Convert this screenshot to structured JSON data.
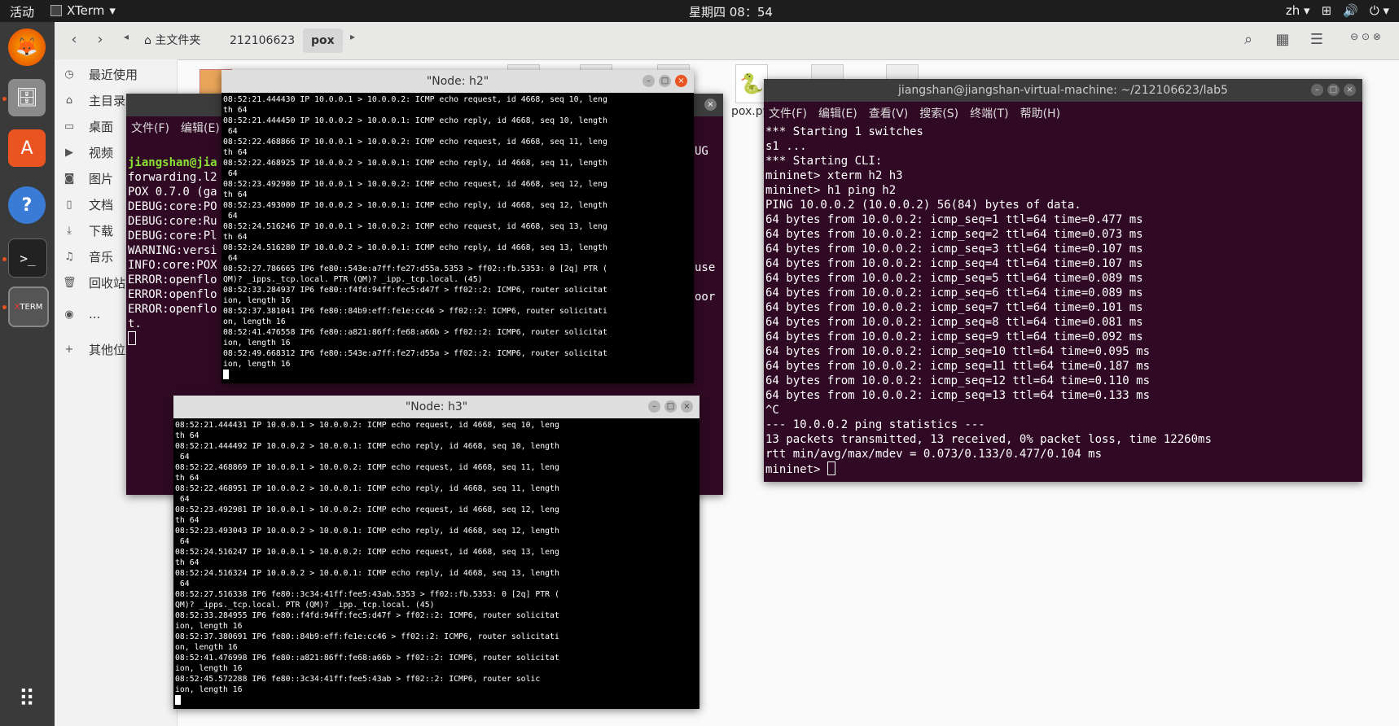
{
  "topbar": {
    "activities": "活动",
    "app_name": "XTerm",
    "clock": "星期四 08：54",
    "lang": "zh"
  },
  "files": {
    "crumbs": [
      "主文件夹",
      "212106623",
      "pox"
    ],
    "sidebar": [
      "最近使用",
      "主目录",
      "桌面",
      "视频",
      "图片",
      "文档",
      "下载",
      "音乐",
      "回收站",
      "...",
      "其他位置"
    ],
    "visible_file": "pox.py"
  },
  "pox_window": {
    "menu": [
      "文件(F)",
      "编辑(E)"
    ],
    "lines": [
      "jiangshan@jia",
      "forwarding.l2",
      "POX 0.7.0 (ga",
      "DEBUG:core:PO",
      "DEBUG:core:Ru",
      "DEBUG:core:Pl",
      "WARNING:versi",
      "INFO:core:POX",
      "ERROR:openflo",
      "ERROR:openflo",
      "ERROR:openflo",
      "t."
    ],
    "right_fragments": [
      "UG",
      "use",
      "oor"
    ]
  },
  "h2": {
    "title": "\"Node: h2\"",
    "lines": [
      "08:52:21.444430 IP 10.0.0.1 > 10.0.0.2: ICMP echo request, id 4668, seq 10, leng",
      "th 64",
      "08:52:21.444450 IP 10.0.0.2 > 10.0.0.1: ICMP echo reply, id 4668, seq 10, length",
      " 64",
      "08:52:22.468866 IP 10.0.0.1 > 10.0.0.2: ICMP echo request, id 4668, seq 11, leng",
      "th 64",
      "08:52:22.468925 IP 10.0.0.2 > 10.0.0.1: ICMP echo reply, id 4668, seq 11, length",
      " 64",
      "08:52:23.492980 IP 10.0.0.1 > 10.0.0.2: ICMP echo request, id 4668, seq 12, leng",
      "th 64",
      "08:52:23.493000 IP 10.0.0.2 > 10.0.0.1: ICMP echo reply, id 4668, seq 12, length",
      " 64",
      "08:52:24.516246 IP 10.0.0.1 > 10.0.0.2: ICMP echo request, id 4668, seq 13, leng",
      "th 64",
      "08:52:24.516280 IP 10.0.0.2 > 10.0.0.1: ICMP echo reply, id 4668, seq 13, length",
      " 64",
      "08:52:27.786665 IP6 fe80::543e:a7ff:fe27:d55a.5353 > ff02::fb.5353: 0 [2q] PTR (",
      "QM)? _ipps._tcp.local. PTR (QM)? _ipp._tcp.local. (45)",
      "08:52:33.284937 IP6 fe80::f4fd:94ff:fec5:d47f > ff02::2: ICMP6, router solicitat",
      "ion, length 16",
      "08:52:37.381041 IP6 fe80::84b9:eff:fe1e:cc46 > ff02::2: ICMP6, router solicitati",
      "on, length 16",
      "08:52:41.476558 IP6 fe80::a821:86ff:fe68:a66b > ff02::2: ICMP6, router solicitat",
      "ion, length 16",
      "08:52:49.668312 IP6 fe80::543e:a7ff:fe27:d55a > ff02::2: ICMP6, router solicitat",
      "ion, length 16"
    ]
  },
  "h3": {
    "title": "\"Node: h3\"",
    "lines": [
      "08:52:21.444431 IP 10.0.0.1 > 10.0.0.2: ICMP echo request, id 4668, seq 10, leng",
      "th 64",
      "08:52:21.444492 IP 10.0.0.2 > 10.0.0.1: ICMP echo reply, id 4668, seq 10, length",
      " 64",
      "08:52:22.468869 IP 10.0.0.1 > 10.0.0.2: ICMP echo request, id 4668, seq 11, leng",
      "th 64",
      "08:52:22.468951 IP 10.0.0.2 > 10.0.0.1: ICMP echo reply, id 4668, seq 11, length",
      " 64",
      "08:52:23.492981 IP 10.0.0.1 > 10.0.0.2: ICMP echo request, id 4668, seq 12, leng",
      "th 64",
      "08:52:23.493043 IP 10.0.0.2 > 10.0.0.1: ICMP echo reply, id 4668, seq 12, length",
      " 64",
      "08:52:24.516247 IP 10.0.0.1 > 10.0.0.2: ICMP echo request, id 4668, seq 13, leng",
      "th 64",
      "08:52:24.516324 IP 10.0.0.2 > 10.0.0.1: ICMP echo reply, id 4668, seq 13, length",
      " 64",
      "08:52:27.516338 IP6 fe80::3c34:41ff:fee5:43ab.5353 > ff02::fb.5353: 0 [2q] PTR (",
      "QM)? _ipps._tcp.local. PTR (QM)? _ipp._tcp.local. (45)",
      "08:52:33.284955 IP6 fe80::f4fd:94ff:fec5:d47f > ff02::2: ICMP6, router solicitat",
      "ion, length 16",
      "08:52:37.380691 IP6 fe80::84b9:eff:fe1e:cc46 > ff02::2: ICMP6, router solicitati",
      "on, length 16",
      "08:52:41.476998 IP6 fe80::a821:86ff:fe68:a66b > ff02::2: ICMP6, router solicitat",
      "ion, length 16",
      "08:52:45.572288 IP6 fe80::3c34:41ff:fee5:43ab > ff02::2: ICMP6, router solic",
      "ion, length 16"
    ]
  },
  "mininet": {
    "title": "jiangshan@jiangshan-virtual-machine: ~/212106623/lab5",
    "menu": [
      "文件(F)",
      "编辑(E)",
      "查看(V)",
      "搜索(S)",
      "终端(T)",
      "帮助(H)"
    ],
    "lines": [
      "*** Starting 1 switches",
      "s1 ...",
      "*** Starting CLI:",
      "mininet> xterm h2 h3",
      "mininet> h1 ping h2",
      "PING 10.0.0.2 (10.0.0.2) 56(84) bytes of data.",
      "64 bytes from 10.0.0.2: icmp_seq=1 ttl=64 time=0.477 ms",
      "64 bytes from 10.0.0.2: icmp_seq=2 ttl=64 time=0.073 ms",
      "64 bytes from 10.0.0.2: icmp_seq=3 ttl=64 time=0.107 ms",
      "64 bytes from 10.0.0.2: icmp_seq=4 ttl=64 time=0.107 ms",
      "64 bytes from 10.0.0.2: icmp_seq=5 ttl=64 time=0.089 ms",
      "64 bytes from 10.0.0.2: icmp_seq=6 ttl=64 time=0.089 ms",
      "64 bytes from 10.0.0.2: icmp_seq=7 ttl=64 time=0.101 ms",
      "64 bytes from 10.0.0.2: icmp_seq=8 ttl=64 time=0.081 ms",
      "64 bytes from 10.0.0.2: icmp_seq=9 ttl=64 time=0.092 ms",
      "64 bytes from 10.0.0.2: icmp_seq=10 ttl=64 time=0.095 ms",
      "64 bytes from 10.0.0.2: icmp_seq=11 ttl=64 time=0.187 ms",
      "64 bytes from 10.0.0.2: icmp_seq=12 ttl=64 time=0.110 ms",
      "64 bytes from 10.0.0.2: icmp_seq=13 ttl=64 time=0.133 ms",
      "^C",
      "--- 10.0.0.2 ping statistics ---",
      "13 packets transmitted, 13 received, 0% packet loss, time 12260ms",
      "rtt min/avg/max/mdev = 0.073/0.133/0.477/0.104 ms"
    ],
    "prompt": "mininet> "
  },
  "colors": {
    "terminal_bg": "#300a24",
    "accent": "#e95420",
    "user_green": "#8ae234"
  }
}
